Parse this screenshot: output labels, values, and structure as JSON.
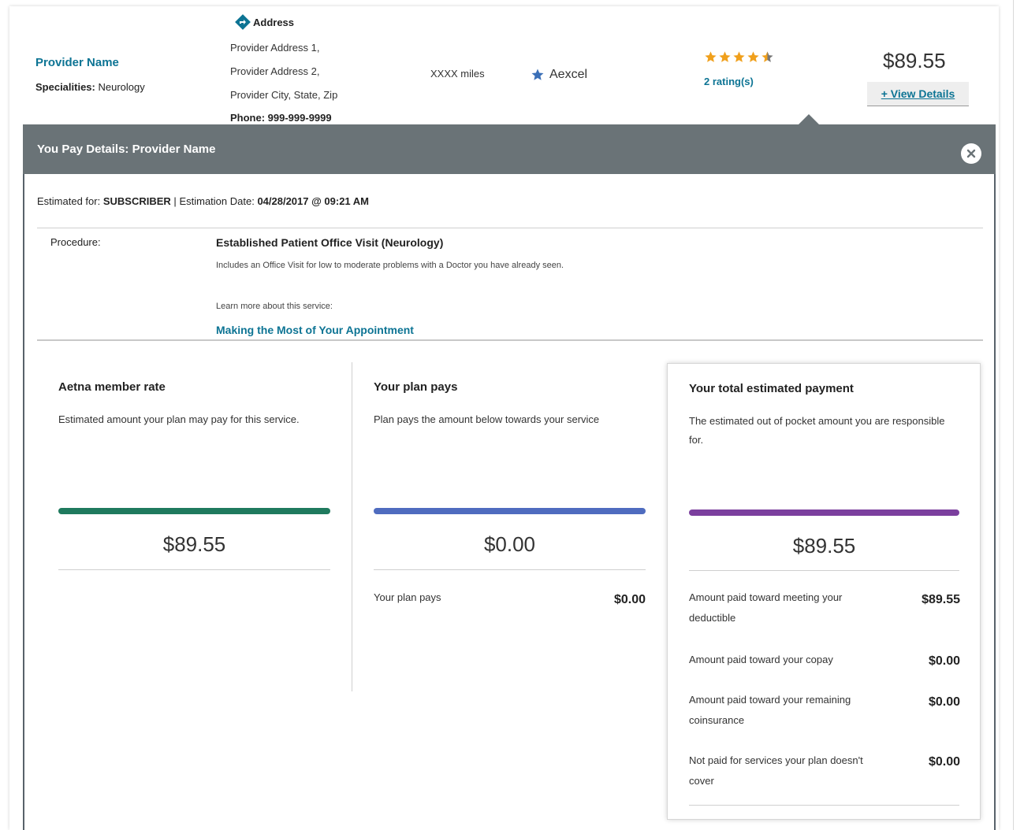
{
  "provider": {
    "name": "Provider Name",
    "specialty_label": "Specialities:",
    "specialty_value": "Neurology",
    "address_heading": "Address",
    "address_line1": "Provider Address 1,",
    "address_line2": "Provider Address 2,",
    "address_line3": "Provider City, State, Zip",
    "phone": "Phone: 999-999-9999",
    "distance": "XXXX miles",
    "network": "Aexcel",
    "rating_stars": 4.5,
    "rating_count": "2 rating(s)",
    "price": "$89.55",
    "view_details": "+ View Details"
  },
  "panel": {
    "title": "You Pay Details: Provider Name",
    "estimated_for_label": "Estimated for:",
    "estimated_for_value": "SUBSCRIBER",
    "separator": "|",
    "estimation_date_label": "Estimation Date:",
    "estimation_date_value": "04/28/2017 @ 09:21 AM",
    "procedure_label": "Procedure:",
    "procedure_name": "Established Patient Office Visit (Neurology)",
    "procedure_desc": "Includes an Office Visit for low to moderate problems with a Doctor you have already seen.",
    "learn_more": "Learn more about this service:",
    "learn_link": "Making the Most of Your Appointment"
  },
  "columns": {
    "member_rate": {
      "title": "Aetna member rate",
      "desc": "Estimated amount your plan may pay for this service.",
      "amount": "$89.55",
      "color": "#1f7a5e"
    },
    "plan_pays": {
      "title": "Your plan pays",
      "desc": "Plan pays the amount below towards your service",
      "amount": "$0.00",
      "color": "#4f6cbf",
      "row_label": "Your plan pays",
      "row_value": "$0.00"
    },
    "total": {
      "title": "Your total estimated payment",
      "desc": "The estimated out of pocket amount you are responsible for.",
      "amount": "$89.55",
      "color": "#7b3f9e",
      "rows": [
        {
          "label": "Amount paid toward meeting your deductible",
          "value": "$89.55"
        },
        {
          "label": "Amount paid toward your copay",
          "value": "$0.00"
        },
        {
          "label": "Amount paid toward your remaining coinsurance",
          "value": "$0.00"
        },
        {
          "label": "Not paid for services your plan doesn't cover",
          "value": "$0.00"
        }
      ]
    }
  },
  "colors": {
    "link": "#0d7494",
    "header_bg": "#6a7377",
    "star": "#f0a01c",
    "network_star": "#3a6fb7"
  }
}
